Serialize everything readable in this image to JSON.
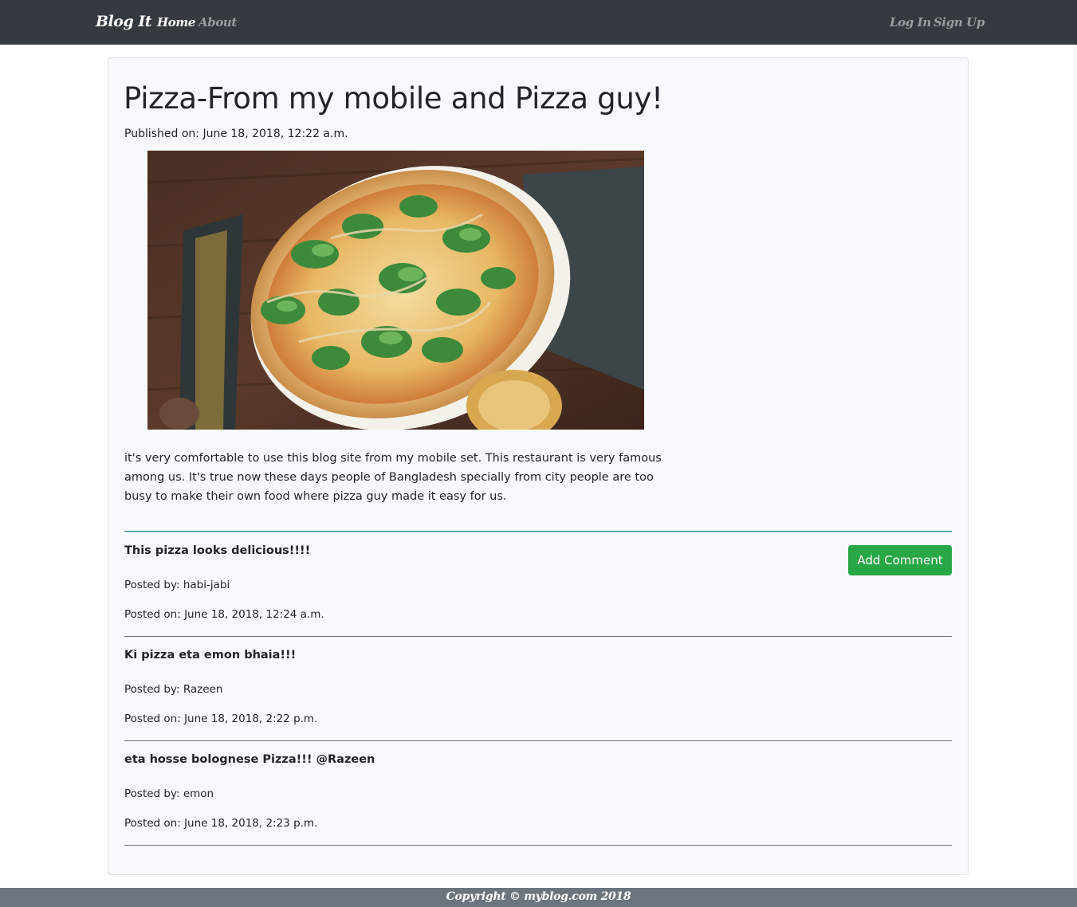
{
  "navbar": {
    "brand": "Blog It",
    "links": [
      "Home",
      "About"
    ],
    "auth": [
      "Log In",
      "Sign Up"
    ]
  },
  "post": {
    "title": "Pizza-From my mobile and Pizza guy!",
    "published": "Published on: June 18, 2018, 12:22 a.m.",
    "body": "it's very comfortable to use this blog site from my mobile set. This restaurant is very famous among us. It's true now these days people of Bangladesh specially from city people are too busy to make their own food where pizza guy made it easy for us.",
    "image_alt": "pizza-photo"
  },
  "actions": {
    "add_comment": "Add Comment"
  },
  "comments": [
    {
      "text": "This pizza looks delicious!!!!",
      "by": "Posted by: habi-jabi",
      "on": "Posted on: June 18, 2018, 12:24 a.m."
    },
    {
      "text": "Ki pizza eta emon bhaia!!!",
      "by": "Posted by: Razeen",
      "on": "Posted on: June 18, 2018, 2:22 p.m."
    },
    {
      "text": "eta hosse bolognese Pizza!!! @Razeen",
      "by": "Posted by: emon",
      "on": "Posted on: June 18, 2018, 2:23 p.m."
    }
  ],
  "footer": {
    "text": "Copyright © myblog.com 2018"
  }
}
